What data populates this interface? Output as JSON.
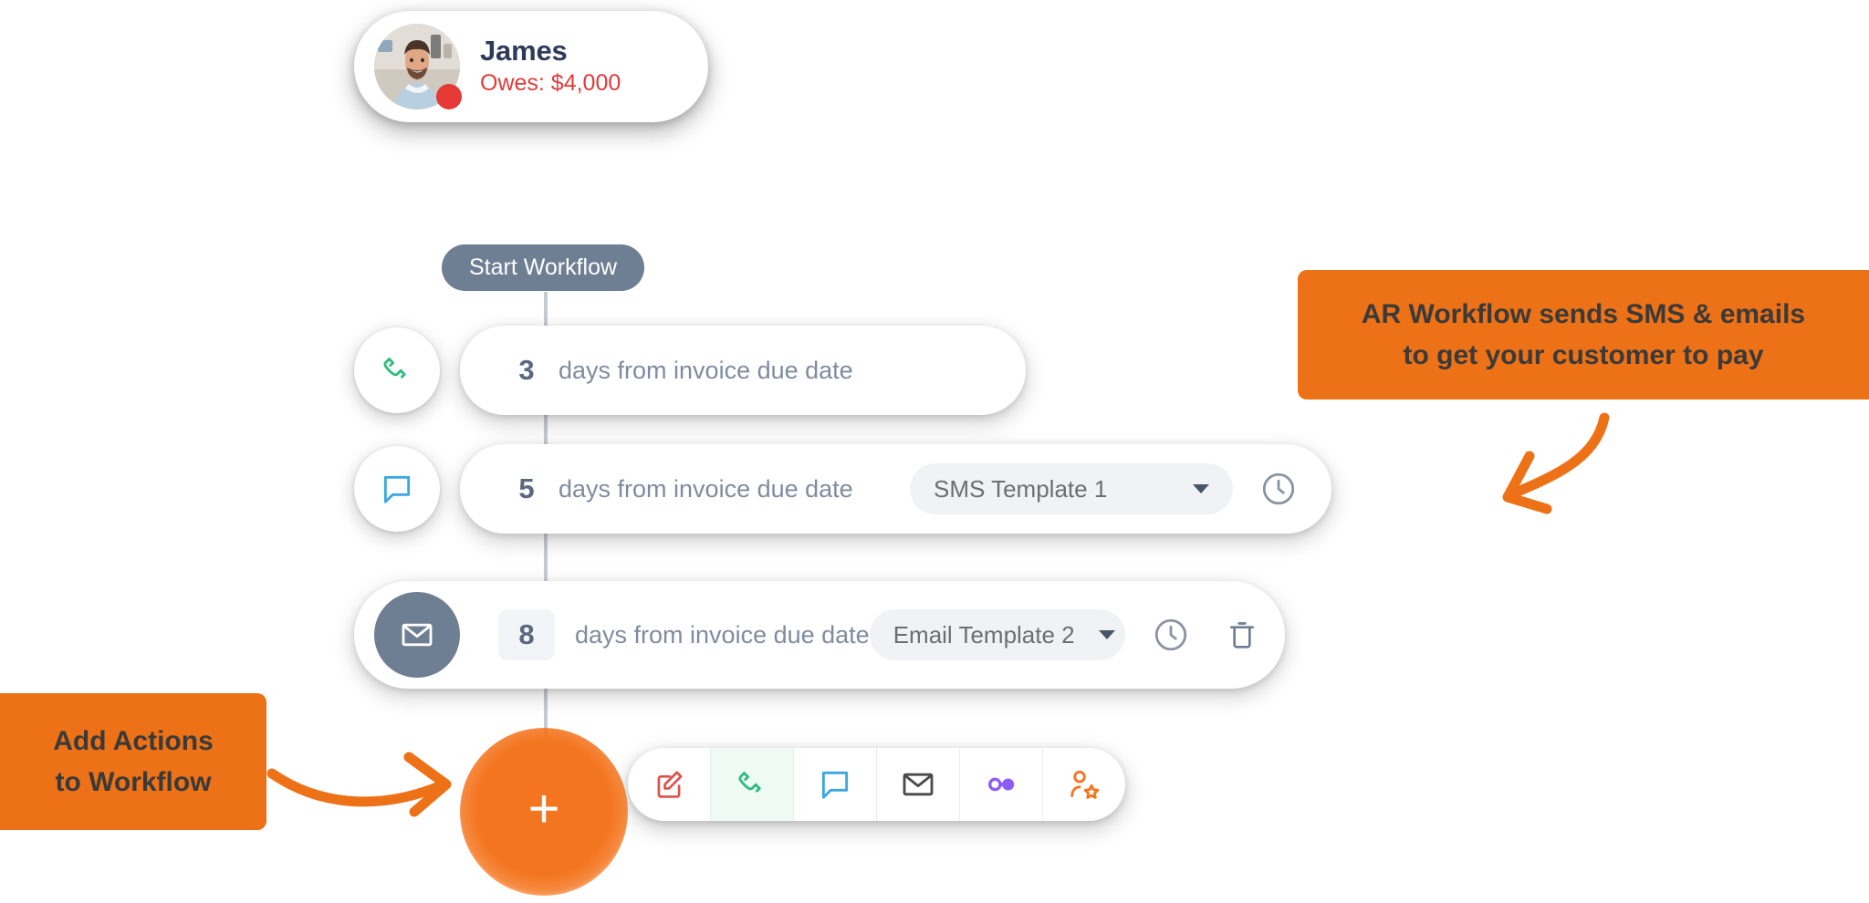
{
  "customer": {
    "name": "James",
    "owes_label": "Owes: $4,000",
    "status_color": "#E53935",
    "name_color": "#2E3A59",
    "owes_color": "#E03B3B",
    "avatar_icon": "person-photo-avatar"
  },
  "workflow": {
    "start_label": "Start Workflow",
    "start_pill_color": "#6E7E93",
    "rows": [
      {
        "icon": "phone-icon",
        "icon_color": "#2EBD7E",
        "days": "3",
        "day_label": "days from invoice due date",
        "template": null,
        "has_clock": false,
        "has_trash": false
      },
      {
        "icon": "chat-bubble-icon",
        "icon_color": "#3BA7E0",
        "days": "5",
        "day_label": "days from invoice due date",
        "template": "SMS Template 1",
        "has_clock": true,
        "has_trash": false
      },
      {
        "icon": "envelope-icon",
        "icon_color": "#FFFFFF",
        "days": "8",
        "day_label": "days from invoice due date",
        "template": "Email Template 2",
        "has_clock": true,
        "has_trash": true
      }
    ]
  },
  "add_button": {
    "glyph": "+",
    "color": "#F4751F"
  },
  "action_toolbar": {
    "actions": [
      {
        "name": "note-edit-icon",
        "color": "#E0504A",
        "active": false
      },
      {
        "name": "phone-icon",
        "color": "#2EBD7E",
        "active": true
      },
      {
        "name": "chat-bubble-icon",
        "color": "#3BA7E0",
        "active": false
      },
      {
        "name": "envelope-icon",
        "color": "#4A4A4A",
        "active": false
      },
      {
        "name": "toggle-link-icon",
        "color": "#8B5CF6",
        "active": false
      },
      {
        "name": "user-star-icon",
        "color": "#F4751F",
        "active": false
      }
    ]
  },
  "callouts": {
    "right": {
      "line1": "AR Workflow sends SMS & emails",
      "line2": "to get your customer to pay",
      "bg_color": "#ED7117",
      "text_color": "#3A3A38"
    },
    "left": {
      "line1": "Add Actions",
      "line2": "to Workflow",
      "bg_color": "#ED7117",
      "text_color": "#3A3A38"
    }
  }
}
